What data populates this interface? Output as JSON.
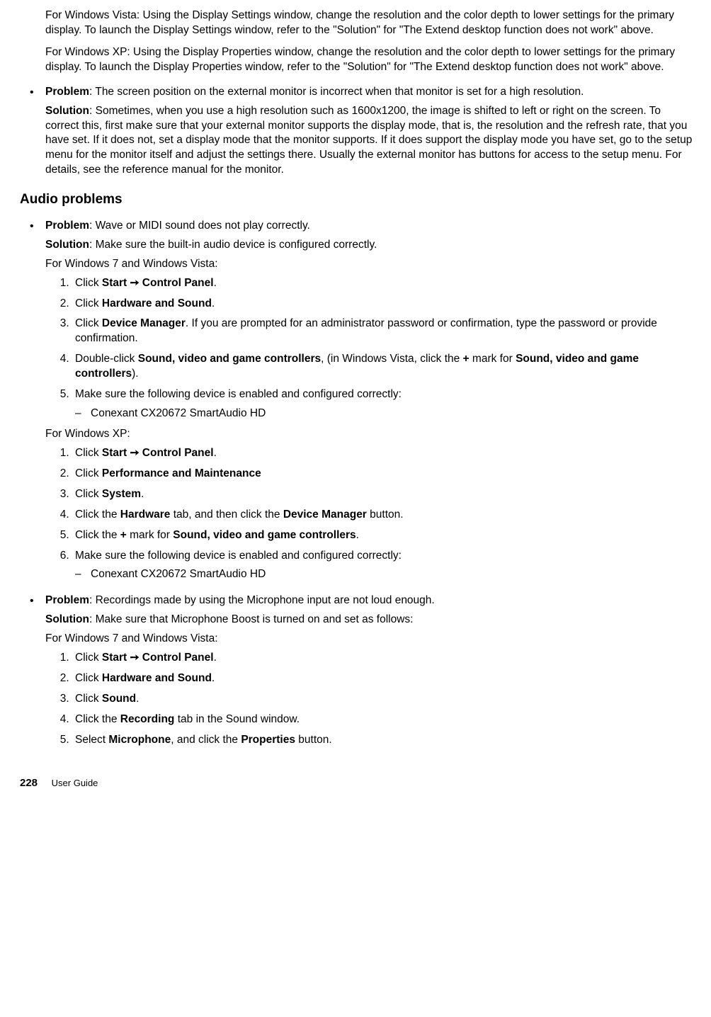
{
  "top_para1_a": "For Windows Vista: Using the Display Settings window, change the resolution and the color depth to lower settings for the primary display. To launch the Display Settings window, refer to the \"Solution\" for \"The Extend desktop function does not work\" above.",
  "top_para2_a": "For Windows XP: Using the Display Properties window, change the resolution and the color depth to lower settings for the primary display. To launch the Display Properties window, refer to the \"Solution\" for \"The Extend desktop function does not work\" above.",
  "bullets": [
    {
      "problem_label": "Problem",
      "problem_text": ": The screen position on the external monitor is incorrect when that monitor is set for a high resolution.",
      "solution_label": "Solution",
      "solution_text": ": Sometimes, when you use a high resolution such as 1600x1200, the image is shifted to left or right on the screen. To correct this, first make sure that your external monitor supports the display mode, that is, the resolution and the refresh rate, that you have set. If it does not, set a display mode that the monitor supports. If it does support the display mode you have set, go to the setup menu for the monitor itself and adjust the settings there. Usually the external monitor has buttons for access to the setup menu. For details, see the reference manual for the monitor."
    }
  ],
  "audio_heading": "Audio problems",
  "audio_bullets": [
    {
      "problem_label": "Problem",
      "problem_text": ": Wave or MIDI sound does not play correctly.",
      "solution_label": "Solution",
      "solution_text": ": Make sure the built-in audio device is configured correctly.",
      "win7_label": "For Windows 7 and Windows Vista:",
      "win7_steps": {
        "s1_pre": "Click ",
        "s1_b1": "Start ➙ Control Panel",
        "s1_post": ".",
        "s2_pre": "Click ",
        "s2_b1": "Hardware and Sound",
        "s2_post": ".",
        "s3_pre": "Click ",
        "s3_b1": "Device Manager",
        "s3_post": ". If you are prompted for an administrator password or confirmation, type the password or provide confirmation.",
        "s4_pre": " Double-click ",
        "s4_b1": "Sound, video and game controllers",
        "s4_mid": ", (in Windows Vista, click the ",
        "s4_b2": "+",
        "s4_mid2": " mark for ",
        "s4_b3": "Sound, video and game controllers",
        "s4_post": ").",
        "s5": "Make sure the following device is enabled and configured correctly:",
        "s5_dash": "Conexant CX20672 SmartAudio HD"
      },
      "winxp_label": "For Windows XP:",
      "winxp_steps": {
        "s1_pre": "Click ",
        "s1_b1": "Start ➙ Control Panel",
        "s1_post": ".",
        "s2_pre": "Click ",
        "s2_b1": "Performance and Maintenance",
        "s3_pre": "Click ",
        "s3_b1": "System",
        "s3_post": ".",
        "s4_pre": "Click the ",
        "s4_b1": "Hardware",
        "s4_mid": " tab, and then click the ",
        "s4_b2": "Device Manager",
        "s4_post": " button.",
        "s5_pre": "Click the ",
        "s5_b1": "+",
        "s5_mid": " mark for ",
        "s5_b2": "Sound, video and game controllers",
        "s5_post": ".",
        "s6": " Make sure the following device is enabled and configured correctly:",
        "s6_dash": "Conexant CX20672 SmartAudio HD"
      }
    },
    {
      "problem_label": "Problem",
      "problem_text": ": Recordings made by using the Microphone input are not loud enough.",
      "solution_label": "Solution",
      "solution_text": ": Make sure that Microphone Boost is turned on and set as follows:",
      "win7_label": "For Windows 7 and Windows Vista:",
      "mic_steps": {
        "s1_pre": "Click ",
        "s1_b1": "Start ➙ Control Panel",
        "s1_post": ".",
        "s2_pre": "Click ",
        "s2_b1": "Hardware and Sound",
        "s2_post": ".",
        "s3_pre": "Click ",
        "s3_b1": "Sound",
        "s3_post": ".",
        "s4_pre": "Click the ",
        "s4_b1": "Recording",
        "s4_post": " tab in the Sound window.",
        "s5_pre": "Select ",
        "s5_b1": "Microphone",
        "s5_mid": ", and click the ",
        "s5_b2": "Properties",
        "s5_post": " button."
      }
    }
  ],
  "footer": {
    "page": "228",
    "doc": "User Guide"
  }
}
